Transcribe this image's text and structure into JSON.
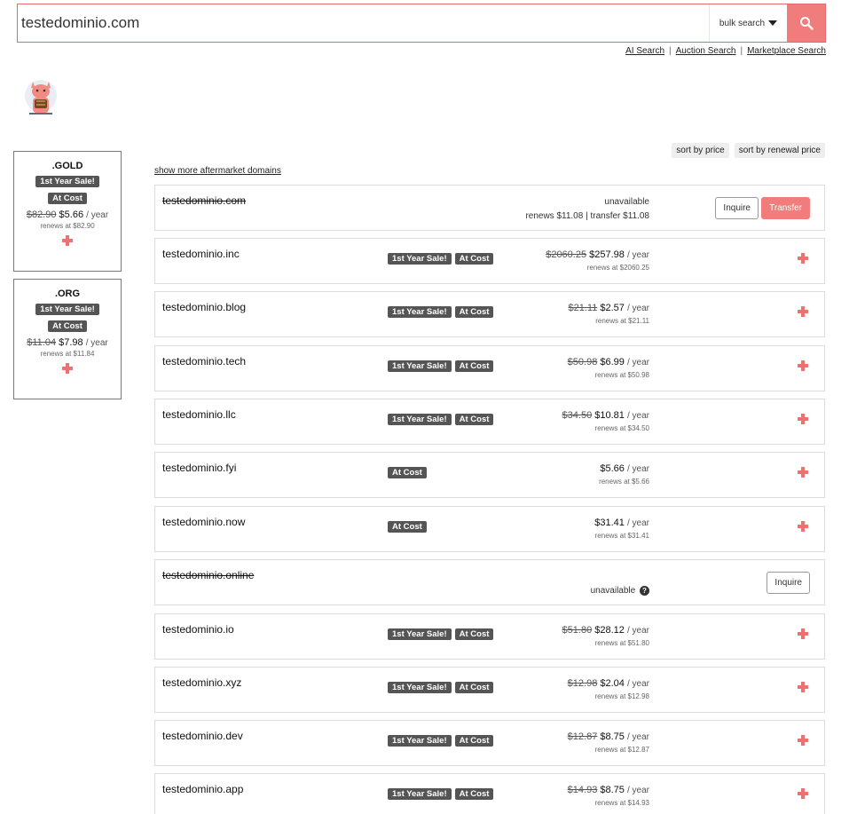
{
  "search": {
    "value": "testedominio.com",
    "bulk_label": "bulk search"
  },
  "links": [
    "AI Search",
    "Auction Search",
    "Marketplace Search"
  ],
  "sort": {
    "by_price": "sort by price",
    "by_renewal": "sort by renewal price"
  },
  "show_more": "show more aftermarket domains",
  "featured": [
    {
      "tld": ".GOLD",
      "badge1": "1st Year Sale!",
      "badge2": "At Cost",
      "old_price": "$82.90",
      "price": "$5.66",
      "per": "/ year",
      "renews": "renews at $82.90"
    },
    {
      "tld": ".ORG",
      "badge1": "1st Year Sale!",
      "badge2": "At Cost",
      "old_price": "$11.04",
      "price": "$7.98",
      "per": "/ year",
      "renews": "renews at $11.84"
    }
  ],
  "main": {
    "name": "testedominio.com",
    "status": "unavailable",
    "renews": "renews $11.08",
    "sep": "|",
    "transfer": "transfer $11.08",
    "inquire": "Inquire",
    "transfer_btn": "Transfer"
  },
  "rows": [
    {
      "name": "testedominio.inc",
      "b1": "1st Year Sale!",
      "b2": "At Cost",
      "old": "$2060.25",
      "price": "$257.98",
      "per": "/ year",
      "renews": "renews at $2060.25"
    },
    {
      "name": "testedominio.blog",
      "b1": "1st Year Sale!",
      "b2": "At Cost",
      "old": "$21.11",
      "price": "$2.57",
      "per": "/ year",
      "renews": "renews at $21.11"
    },
    {
      "name": "testedominio.tech",
      "b1": "1st Year Sale!",
      "b2": "At Cost",
      "old": "$50.98",
      "price": "$6.99",
      "per": "/ year",
      "renews": "renews at $50.98"
    },
    {
      "name": "testedominio.llc",
      "b1": "1st Year Sale!",
      "b2": "At Cost",
      "old": "$34.50",
      "price": "$10.81",
      "per": "/ year",
      "renews": "renews at $34.50"
    },
    {
      "name": "testedominio.fyi",
      "b1": "At Cost",
      "price": "$5.66",
      "per": "/ year",
      "renews": "renews at $5.66"
    },
    {
      "name": "testedominio.now",
      "b1": "At Cost",
      "price": "$31.41",
      "per": "/ year",
      "renews": "renews at $31.41"
    },
    {
      "name": "testedominio.online",
      "status": "unavailable",
      "inquire": "Inquire"
    },
    {
      "name": "testedominio.io",
      "b1": "1st Year Sale!",
      "b2": "At Cost",
      "old": "$51.80",
      "price": "$28.12",
      "per": "/ year",
      "renews": "renews at $51.80"
    },
    {
      "name": "testedominio.xyz",
      "b1": "1st Year Sale!",
      "b2": "At Cost",
      "old": "$12.98",
      "price": "$2.04",
      "per": "/ year",
      "renews": "renews at $12.98"
    },
    {
      "name": "testedominio.dev",
      "b1": "1st Year Sale!",
      "b2": "At Cost",
      "old": "$12.87",
      "price": "$8.75",
      "per": "/ year",
      "renews": "renews at $12.87"
    },
    {
      "name": "testedominio.app",
      "b1": "1st Year Sale!",
      "b2": "At Cost",
      "old": "$14.93",
      "price": "$8.75",
      "per": "/ year",
      "renews": "renews at $14.93"
    }
  ],
  "colors": {
    "accent": "#f07c7c",
    "badge": "#555555"
  }
}
